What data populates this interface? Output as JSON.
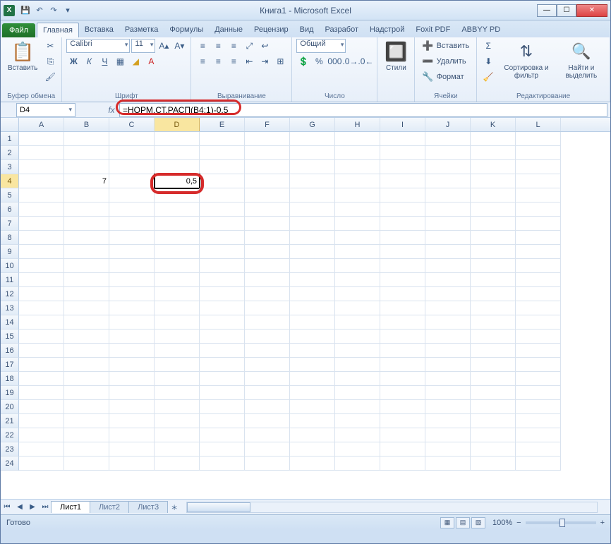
{
  "window": {
    "title": "Книга1 - Microsoft Excel"
  },
  "tabs": {
    "file": "Файл",
    "items": [
      "Главная",
      "Вставка",
      "Разметка",
      "Формулы",
      "Данные",
      "Рецензир",
      "Вид",
      "Разработ",
      "Надстрой",
      "Foxit PDF",
      "ABBYY PD"
    ],
    "active_index": 0
  },
  "ribbon": {
    "clipboard": {
      "label": "Буфер обмена",
      "paste": "Вставить"
    },
    "font": {
      "label": "Шрифт",
      "name": "Calibri",
      "size": "11",
      "bold": "Ж",
      "italic": "К",
      "underline": "Ч"
    },
    "alignment": {
      "label": "Выравнивание"
    },
    "number": {
      "label": "Число",
      "format": "Общий"
    },
    "styles": {
      "label": "Стили"
    },
    "cells": {
      "label": "Ячейки",
      "insert": "Вставить",
      "delete": "Удалить",
      "format": "Формат"
    },
    "editing": {
      "label": "Редактирование",
      "sort": "Сортировка и фильтр",
      "find": "Найти и выделить"
    }
  },
  "namebox": {
    "value": "D4"
  },
  "formula": {
    "value": "=НОРМ.СТ.РАСП(B4;1)-0,5"
  },
  "grid": {
    "columns": [
      "A",
      "B",
      "C",
      "D",
      "E",
      "F",
      "G",
      "H",
      "I",
      "J",
      "K",
      "L"
    ],
    "row_count": 24,
    "active_col": "D",
    "active_row": 4,
    "cells": {
      "B4": "7",
      "D4": "0,5"
    }
  },
  "sheets": {
    "items": [
      "Лист1",
      "Лист2",
      "Лист3"
    ],
    "active_index": 0
  },
  "status": {
    "ready": "Готово",
    "zoom": "100%"
  }
}
